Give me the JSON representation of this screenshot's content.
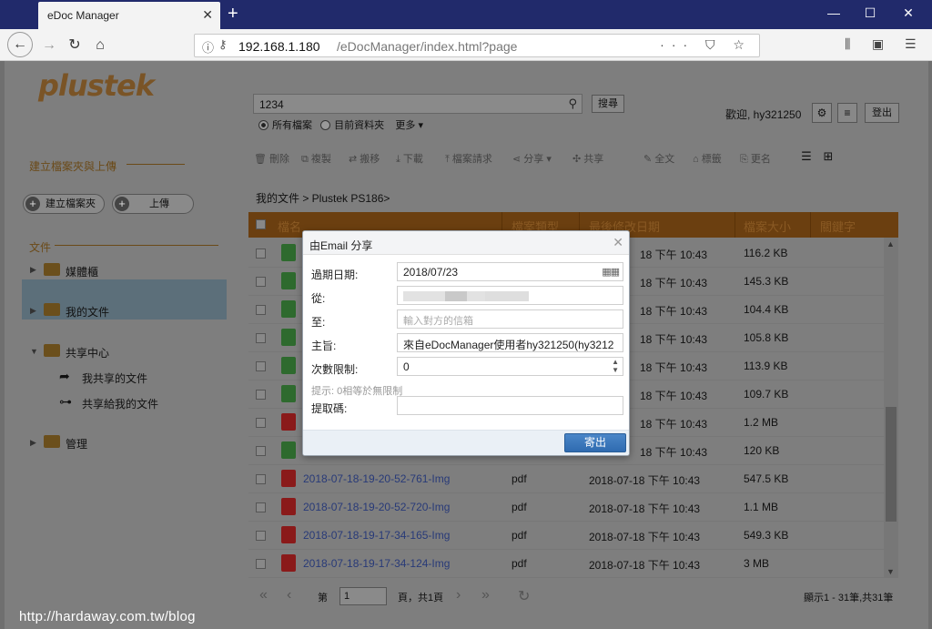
{
  "browser": {
    "tab_title": "eDoc Manager",
    "url_host": "192.168.1.180",
    "url_path": "/eDocManager/index.html?page"
  },
  "app": {
    "logo": "plustek",
    "search": {
      "value": "1234",
      "button": "搜尋"
    },
    "scope": {
      "all": "所有檔案",
      "current": "目前資料夾",
      "more": "更多"
    },
    "welcome": "歡迎, hy321250",
    "logout": "登出",
    "sidebar": {
      "create_section": "建立檔案夾與上傳",
      "create_folder": "建立檔案夾",
      "upload": "上傳",
      "files_section": "文件",
      "media": "媒體櫃",
      "my_docs": "我的文件",
      "share_center": "共享中心",
      "my_shared": "我共享的文件",
      "shared_with_me": "共享給我的文件",
      "admin": "管理"
    },
    "toolbar": {
      "delete": "刪除",
      "copy": "複製",
      "move": "搬移",
      "download": "下載",
      "request": "檔案請求",
      "share": "分享",
      "cooperate": "共享",
      "fulltext": "全文",
      "tag": "標籤",
      "rename": "更名"
    },
    "breadcrumb": "我的文件 > Plustek PS186>",
    "columns": {
      "name": "檔名",
      "type": "檔案類型",
      "modified": "最後修改日期",
      "size": "檔案大小",
      "keyword": "關鍵字"
    },
    "rows": [
      {
        "icon": "img",
        "name": "",
        "type": "",
        "date": "18 下午 10:43",
        "size": "116.2 KB"
      },
      {
        "icon": "img",
        "name": "",
        "type": "",
        "date": "18 下午 10:43",
        "size": "145.3 KB"
      },
      {
        "icon": "img",
        "name": "",
        "type": "",
        "date": "18 下午 10:43",
        "size": "104.4 KB"
      },
      {
        "icon": "img",
        "name": "",
        "type": "",
        "date": "18 下午 10:43",
        "size": "105.8 KB"
      },
      {
        "icon": "img",
        "name": "",
        "type": "",
        "date": "18 下午 10:43",
        "size": "113.9 KB"
      },
      {
        "icon": "img",
        "name": "",
        "type": "",
        "date": "18 下午 10:43",
        "size": "109.7 KB"
      },
      {
        "icon": "pdf",
        "name": "",
        "type": "",
        "date": "18 下午 10:43",
        "size": "1.2 MB"
      },
      {
        "icon": "img",
        "name": "",
        "type": "",
        "date": "18 下午 10:43",
        "size": "120 KB"
      },
      {
        "icon": "pdf",
        "name": "2018-07-18-19-20-52-761-Img",
        "type": "pdf",
        "date": "2018-07-18 下午 10:43",
        "size": "547.5 KB"
      },
      {
        "icon": "pdf",
        "name": "2018-07-18-19-20-52-720-Img",
        "type": "pdf",
        "date": "2018-07-18 下午 10:43",
        "size": "1.1 MB"
      },
      {
        "icon": "pdf",
        "name": "2018-07-18-19-17-34-165-Img",
        "type": "pdf",
        "date": "2018-07-18 下午 10:43",
        "size": "549.3 KB"
      },
      {
        "icon": "pdf",
        "name": "2018-07-18-19-17-34-124-Img",
        "type": "pdf",
        "date": "2018-07-18 下午 10:43",
        "size": "3 MB"
      }
    ],
    "pager": {
      "page_label": "第",
      "page_value": "1",
      "of_label": "頁，共1頁",
      "summary": "顯示1 - 31筆,共31筆"
    }
  },
  "dialog": {
    "title": "由Email 分享",
    "expire_label": "過期日期:",
    "expire_value": "2018/07/23",
    "from_label": "從:",
    "to_label": "至:",
    "to_placeholder": "輸入對方的信箱",
    "subject_label": "主旨:",
    "subject_value": "來自eDocManager使用者hy321250(hy3212",
    "limit_label": "次數限制:",
    "limit_value": "0",
    "hint": "提示: 0相等於無限制",
    "code_label": "提取碼:",
    "send_button": "寄出"
  },
  "watermark": "http://hardaway.com.tw/blog",
  "colors": {
    "title_bar": "#212a6b",
    "send_button": "#3a78bd",
    "link": "#283a78"
  }
}
